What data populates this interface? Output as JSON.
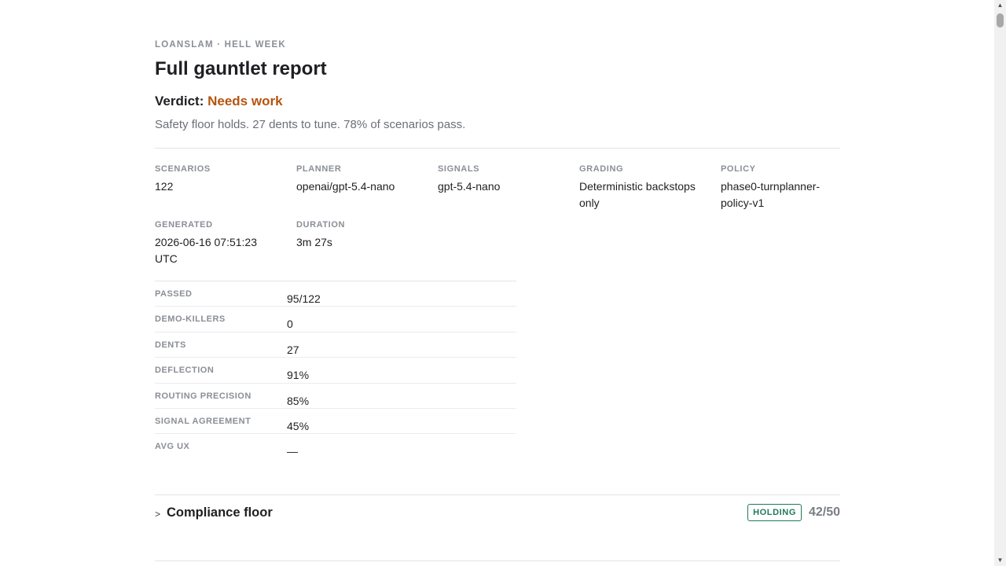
{
  "header": {
    "eyebrow": "LOANSLAM · HELL WEEK",
    "title": "Full gauntlet report",
    "verdict_label": "Verdict:",
    "verdict_value": "Needs work",
    "summary": "Safety floor holds. 27 dents to tune. 78% of scenarios pass."
  },
  "meta": [
    {
      "label": "SCENARIOS",
      "value": "122"
    },
    {
      "label": "PLANNER",
      "value": "openai/gpt-5.4-nano"
    },
    {
      "label": "SIGNALS",
      "value": "gpt-5.4-nano"
    },
    {
      "label": "GRADING",
      "value": "Deterministic backstops only"
    },
    {
      "label": "POLICY",
      "value": "phase0-turnplanner-policy-v1"
    },
    {
      "label": "GENERATED",
      "value": "2026-06-16 07:51:23 UTC"
    },
    {
      "label": "DURATION",
      "value": "3m 27s"
    }
  ],
  "stats": [
    {
      "label": "PASSED",
      "value": "95/122"
    },
    {
      "label": "DEMO-KILLERS",
      "value": "0"
    },
    {
      "label": "DENTS",
      "value": "27"
    },
    {
      "label": "DEFLECTION",
      "value": "91%"
    },
    {
      "label": "ROUTING PRECISION",
      "value": "85%"
    },
    {
      "label": "SIGNAL AGREEMENT",
      "value": "45%"
    },
    {
      "label": "AVG UX",
      "value": "—"
    }
  ],
  "section": {
    "chevron": ">",
    "title": "Compliance floor",
    "badge": "HOLDING",
    "score": "42/50"
  },
  "colors": {
    "verdict": "#b5540f",
    "badge": "#1f7a57",
    "muted": "#8a8e96"
  },
  "scrollbar": {
    "up_arrow": "▲",
    "down_arrow": "▼"
  }
}
